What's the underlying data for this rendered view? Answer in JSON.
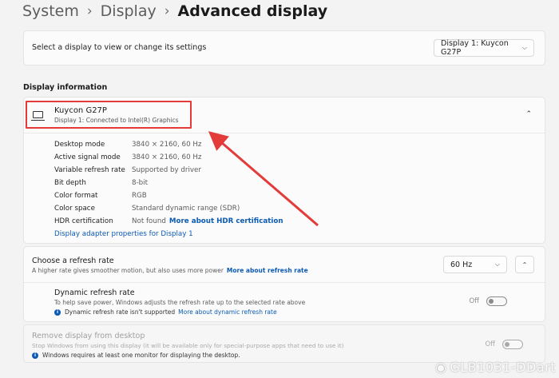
{
  "breadcrumb": {
    "items": [
      "System",
      "Display"
    ],
    "current": "Advanced display"
  },
  "display_select": {
    "label": "Select a display to view or change its settings",
    "value": "Display 1: Kuycon G27P"
  },
  "display_info": {
    "section_title": "Display information",
    "name": "Kuycon G27P",
    "subtitle": "Display 1: Connected to Intel(R) Graphics",
    "properties": [
      {
        "key": "Desktop mode",
        "value": "3840 × 2160, 60 Hz"
      },
      {
        "key": "Active signal mode",
        "value": "3840 × 2160, 60 Hz"
      },
      {
        "key": "Variable refresh rate",
        "value": "Supported by driver"
      },
      {
        "key": "Bit depth",
        "value": "8-bit"
      },
      {
        "key": "Color format",
        "value": "RGB"
      },
      {
        "key": "Color space",
        "value": "Standard dynamic range (SDR)"
      },
      {
        "key": "HDR certification",
        "value": "Not found",
        "link": "More about HDR certification"
      }
    ],
    "adapter_link": "Display adapter properties for Display 1"
  },
  "refresh": {
    "title": "Choose a refresh rate",
    "subtitle": "A higher rate gives smoother motion, but also uses more power",
    "subtitle_link": "More about refresh rate",
    "value": "60 Hz",
    "dynamic_title": "Dynamic refresh rate",
    "dynamic_subtitle": "To help save power, Windows adjusts the refresh rate up to the selected rate above",
    "dynamic_note": "Dynamic refresh rate isn't supported",
    "dynamic_note_link": "More about dynamic refresh rate",
    "dynamic_toggle_label": "Off"
  },
  "remove_display": {
    "title": "Remove display from desktop",
    "subtitle": "Stop Windows from using this display (it will be available only for special-purpose apps that need to use it)",
    "note": "Windows requires at least one monitor for displaying the desktop.",
    "toggle_label": "Off"
  },
  "watermark": {
    "text": "GLB1031-DDart"
  },
  "colors": {
    "link": "#0b5ab3",
    "annotation_red": "#e33a3a"
  }
}
